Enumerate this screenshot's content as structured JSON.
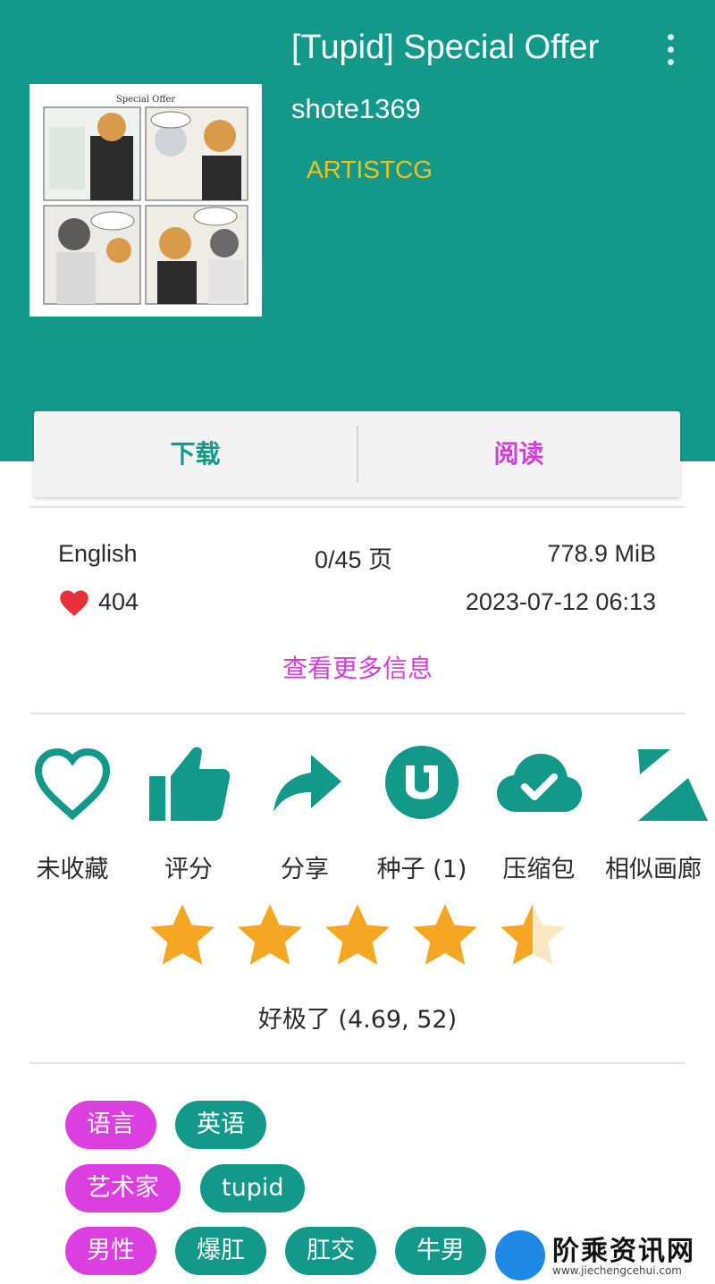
{
  "gallery": {
    "title": "[Tupid] Special Offer",
    "uploader": "shote1369",
    "category": "ARTISTCG",
    "cover_text": "Special Offer"
  },
  "actions": {
    "download": "下载",
    "read": "阅读"
  },
  "info": {
    "language": "English",
    "pages": "0/45 页",
    "size": "778.9 MiB",
    "favorites": "404",
    "posted": "2023-07-12 06:13",
    "more_info": "查看更多信息"
  },
  "tools": [
    {
      "label": "未收藏",
      "icon": "heart-outline-icon"
    },
    {
      "label": "评分",
      "icon": "thumb-up-icon"
    },
    {
      "label": "分享",
      "icon": "share-icon"
    },
    {
      "label": "种子 (1)",
      "icon": "torrent-icon"
    },
    {
      "label": "压缩包",
      "icon": "cloud-done-icon"
    },
    {
      "label": "相似画廊",
      "icon": "similar-icon"
    }
  ],
  "rating": {
    "value": 4.69,
    "max": 5,
    "count": 52,
    "text": "好极了 (4.69, 52)"
  },
  "tags": [
    {
      "namespace": "语言",
      "values": [
        "英语"
      ]
    },
    {
      "namespace": "艺术家",
      "values": [
        "tupid"
      ]
    },
    {
      "namespace": "男性",
      "values": [
        "爆肛",
        "肛交",
        "牛男"
      ]
    }
  ],
  "watermark": {
    "brand": "阶乘资讯网",
    "site": "www.jiechengcehui.com"
  },
  "colors": {
    "primary": "#12998a",
    "accent": "#dc3fe0",
    "category": "#f2c21a",
    "star": "#f5a623"
  }
}
